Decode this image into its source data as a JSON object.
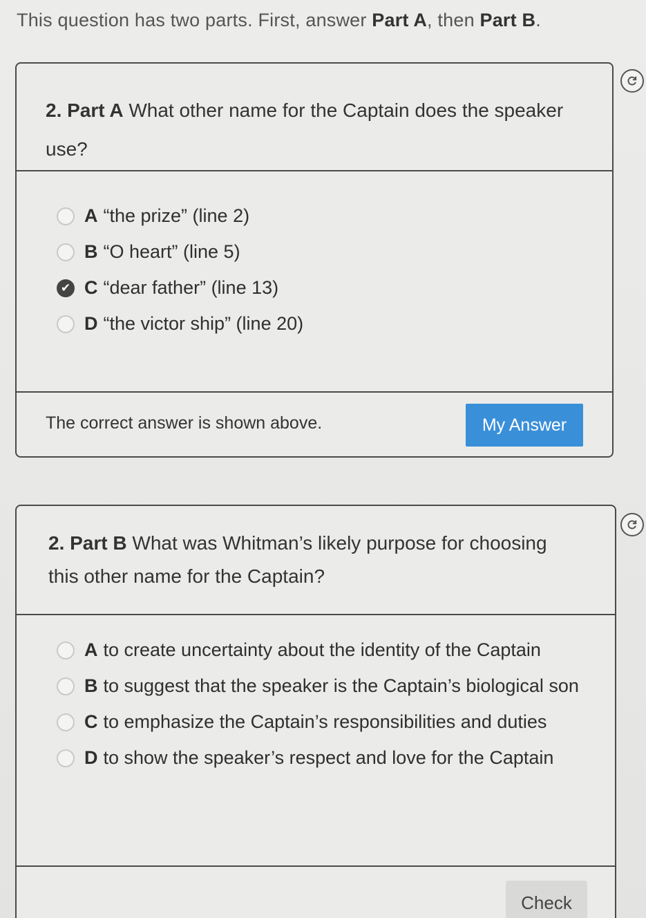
{
  "instructions": {
    "prefix": "This question has two parts. First, answer ",
    "part_a": "Part A",
    "middle": ", then ",
    "part_b": "Part B",
    "suffix": "."
  },
  "part_a": {
    "number": "2. Part A",
    "question": "What other name for the Captain does the speaker use?",
    "options": [
      {
        "letter": "A",
        "text": "“the prize” (line 2)",
        "selected": false
      },
      {
        "letter": "B",
        "text": "“O heart” (line 5)",
        "selected": false
      },
      {
        "letter": "C",
        "text": "“dear father” (line 13)",
        "selected": true
      },
      {
        "letter": "D",
        "text": "“the victor ship” (line 20)",
        "selected": false
      }
    ],
    "feedback": "The correct answer is shown above.",
    "my_answer_label": "My Answer"
  },
  "part_b": {
    "number": "2. Part B",
    "question": "What was Whitman’s likely purpose for choosing this other name for the Captain?",
    "options": [
      {
        "letter": "A",
        "text": "to create uncertainty about the identity of the Captain",
        "selected": false
      },
      {
        "letter": "B",
        "text": "to suggest that the speaker is the Captain’s biological son",
        "selected": false
      },
      {
        "letter": "C",
        "text": "to emphasize the Captain’s responsibilities and duties",
        "selected": false
      },
      {
        "letter": "D",
        "text": "to show the speaker’s respect and love for the Captain",
        "selected": false
      }
    ],
    "check_label": "Check"
  },
  "colors": {
    "accent": "#3a8fd9",
    "border": "#4a4a4a",
    "selected_radio": "#444444"
  },
  "icons": {
    "reset": "reset-icon",
    "selected": "check-icon"
  }
}
